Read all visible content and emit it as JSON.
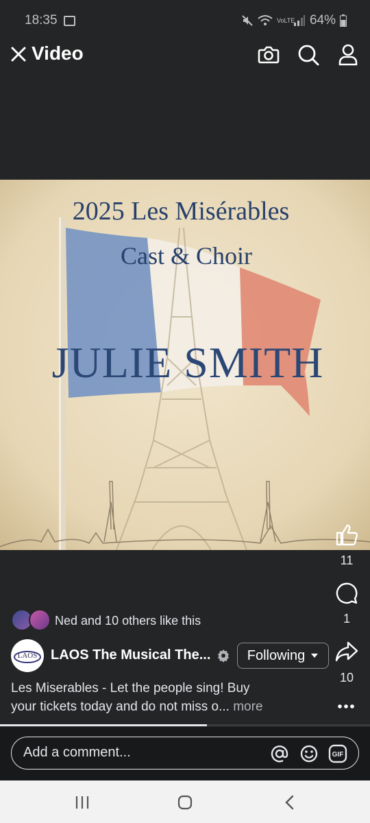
{
  "status_bar": {
    "time": "18:35",
    "battery": "64%",
    "network_label": "VoLTE"
  },
  "header": {
    "title": "Video",
    "icons": [
      "close-icon",
      "camera-icon",
      "search-icon",
      "profile-icon"
    ]
  },
  "poster": {
    "line1": "2025 Les Misérables",
    "line2": "Cast & Choir",
    "name": "JULIE SMITH"
  },
  "actions": {
    "likes": "11",
    "comments": "1",
    "shares": "10"
  },
  "likes_summary": "Ned and 10 others like this",
  "page": {
    "name": "LAOS The Musical The...",
    "logo_text": "LAOS",
    "follow_label": "Following"
  },
  "caption": {
    "line1": "Les Miserables - Let the people sing! Buy",
    "line2": "your tickets today and do not miss o...",
    "more": "more"
  },
  "progress": 0.56,
  "comment": {
    "placeholder": "Add a comment...",
    "gif_label": "GIF"
  },
  "colors": {
    "background": "#242526",
    "poster_text": "#27406b",
    "nav_bar": "#f2f2f2"
  }
}
